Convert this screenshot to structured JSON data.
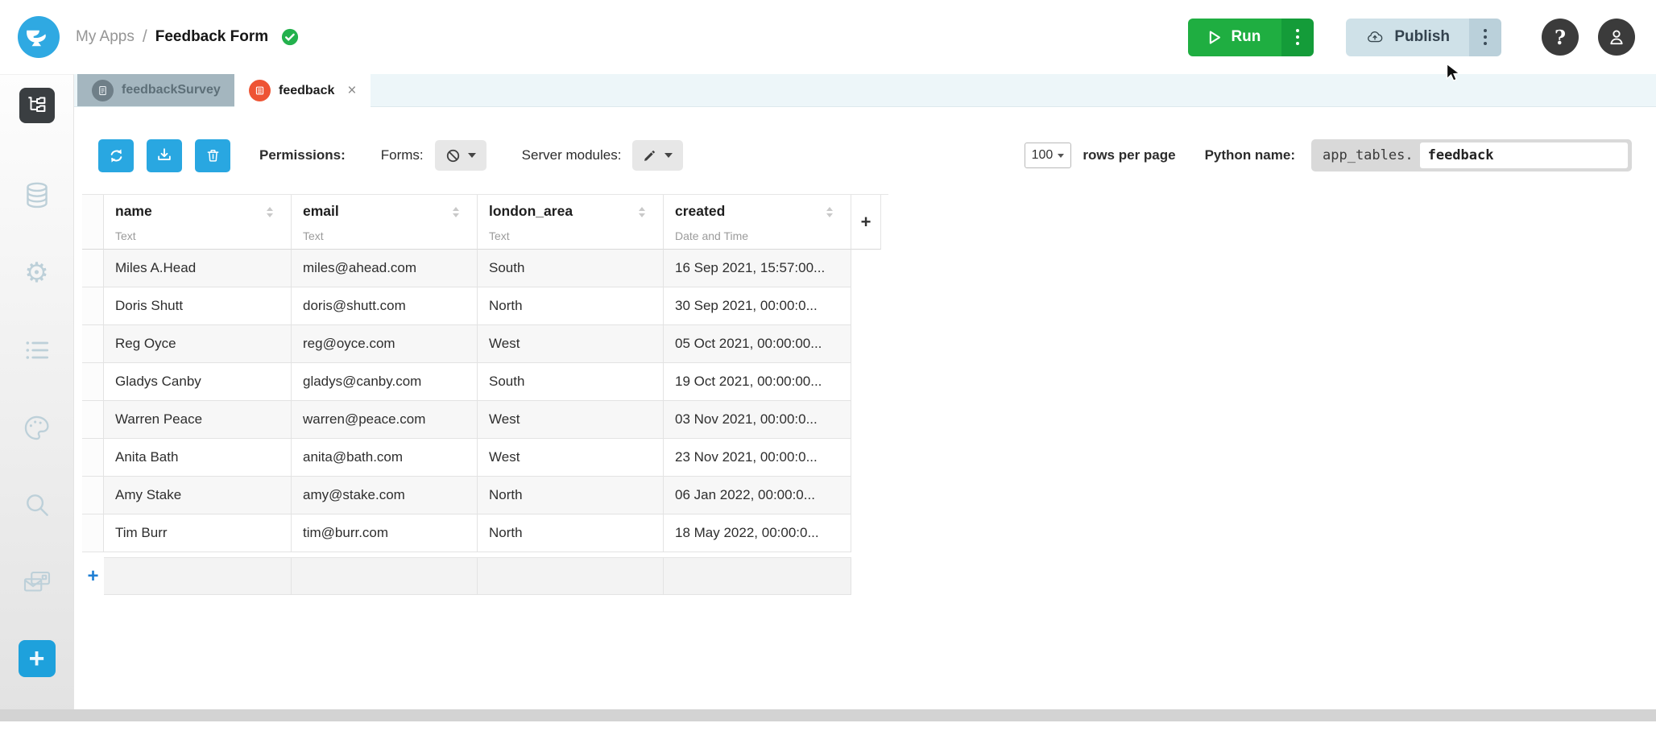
{
  "header": {
    "breadcrumb_section": "My Apps",
    "breadcrumb_separator": "/",
    "app_title": "Feedback Form",
    "run_label": "Run",
    "publish_label": "Publish",
    "help_glyph": "?"
  },
  "tabs": [
    {
      "label": "feedbackSurvey"
    },
    {
      "label": "feedback",
      "close_glyph": "×"
    }
  ],
  "toolbar": {
    "permissions_label": "Permissions:",
    "forms_label": "Forms:",
    "server_modules_label": "Server modules:",
    "rows_per_page_value": "100",
    "rows_per_page_label": "rows per page",
    "python_name_label": "Python name:",
    "python_prefix": "app_tables.",
    "python_value": "feedback"
  },
  "table": {
    "columns": [
      {
        "name": "name",
        "type": "Text"
      },
      {
        "name": "email",
        "type": "Text"
      },
      {
        "name": "london_area",
        "type": "Text"
      },
      {
        "name": "created",
        "type": "Date and Time"
      }
    ],
    "add_column_glyph": "+",
    "add_row_glyph": "+",
    "rows": [
      {
        "name": "Miles A.Head",
        "email": "miles@ahead.com",
        "london_area": "South",
        "created": "16 Sep 2021, 15:57:00..."
      },
      {
        "name": "Doris Shutt",
        "email": "doris@shutt.com",
        "london_area": "North",
        "created": "30 Sep 2021, 00:00:0..."
      },
      {
        "name": "Reg Oyce",
        "email": "reg@oyce.com",
        "london_area": "West",
        "created": "05 Oct 2021, 00:00:00..."
      },
      {
        "name": "Gladys Canby",
        "email": "gladys@canby.com",
        "london_area": "South",
        "created": "19 Oct 2021, 00:00:00..."
      },
      {
        "name": "Warren Peace",
        "email": "warren@peace.com",
        "london_area": "West",
        "created": "03 Nov 2021, 00:00:0..."
      },
      {
        "name": "Anita Bath",
        "email": "anita@bath.com",
        "london_area": "West",
        "created": "23 Nov 2021, 00:00:0..."
      },
      {
        "name": "Amy Stake",
        "email": "amy@stake.com",
        "london_area": "North",
        "created": "06 Jan 2022, 00:00:0..."
      },
      {
        "name": "Tim Burr",
        "email": "tim@burr.com",
        "london_area": "North",
        "created": "18 May 2022, 00:00:0..."
      }
    ]
  },
  "sidebar": {
    "icons": [
      "app-structure",
      "data-tables",
      "settings",
      "app-logs",
      "theme",
      "search",
      "email-services",
      "add-component"
    ]
  },
  "colors": {
    "anvil_blue": "#29a7e1",
    "run_green": "#1fae41",
    "publish_bg": "#cfe1e8",
    "tab_orange": "#ee5434",
    "inactive_tab_bg": "#a4b6bf",
    "tabstrip_bg": "#edf6f9",
    "check_green": "#23b14d"
  }
}
